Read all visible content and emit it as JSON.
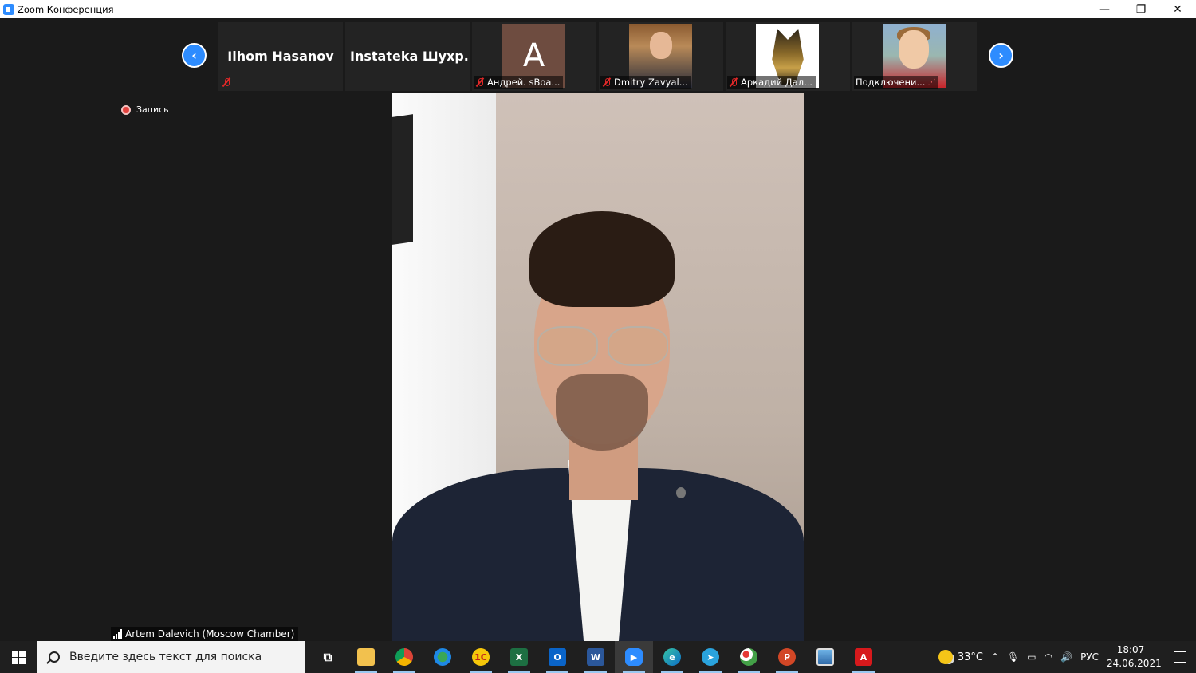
{
  "window": {
    "title": "Zoom Конференция",
    "minimize": "—",
    "restore": "❐",
    "close": "✕"
  },
  "participants_strip": {
    "prev": "‹",
    "next": "›",
    "tiles": [
      {
        "name": "Ilhom Hasanov",
        "kind": "name-only",
        "muted": true
      },
      {
        "name": "Instateka  Шухр...",
        "kind": "name-only",
        "muted": false
      },
      {
        "name": "Андрей. sBoa...",
        "kind": "avatar",
        "avatar_letter": "A",
        "muted": true
      },
      {
        "name": "Dmitry Zavyal...",
        "kind": "photo",
        "muted": true
      },
      {
        "name": "Аркадий Дал...",
        "kind": "photo",
        "muted": true
      },
      {
        "name": "Подключени...",
        "kind": "photo",
        "muted": false
      }
    ]
  },
  "recording": {
    "label": "Запись"
  },
  "active_speaker": {
    "name": "Artem Dalevich (Moscow Chamber)"
  },
  "taskbar": {
    "search_placeholder": "Введите здесь текст для поиска",
    "apps": [
      {
        "name": "task-view",
        "label": "⧉"
      },
      {
        "name": "file-explorer",
        "label": ""
      },
      {
        "name": "chrome",
        "label": ""
      },
      {
        "name": "maps",
        "label": ""
      },
      {
        "name": "1c",
        "label": "1С"
      },
      {
        "name": "excel",
        "label": "X"
      },
      {
        "name": "outlook",
        "label": "O"
      },
      {
        "name": "word",
        "label": "W"
      },
      {
        "name": "zoom",
        "label": "▶"
      },
      {
        "name": "edge",
        "label": "e"
      },
      {
        "name": "telegram",
        "label": "➤"
      },
      {
        "name": "paint",
        "label": ""
      },
      {
        "name": "powerpoint",
        "label": "P"
      },
      {
        "name": "screen-tool",
        "label": ""
      },
      {
        "name": "acrobat",
        "label": "A"
      }
    ],
    "weather": "33°C",
    "language": "РУС",
    "time": "18:07",
    "date": "24.06.2021"
  },
  "colors": {
    "zoom_blue": "#2D8CFF",
    "mute_red": "#e02828",
    "record_red": "#e4433f"
  }
}
